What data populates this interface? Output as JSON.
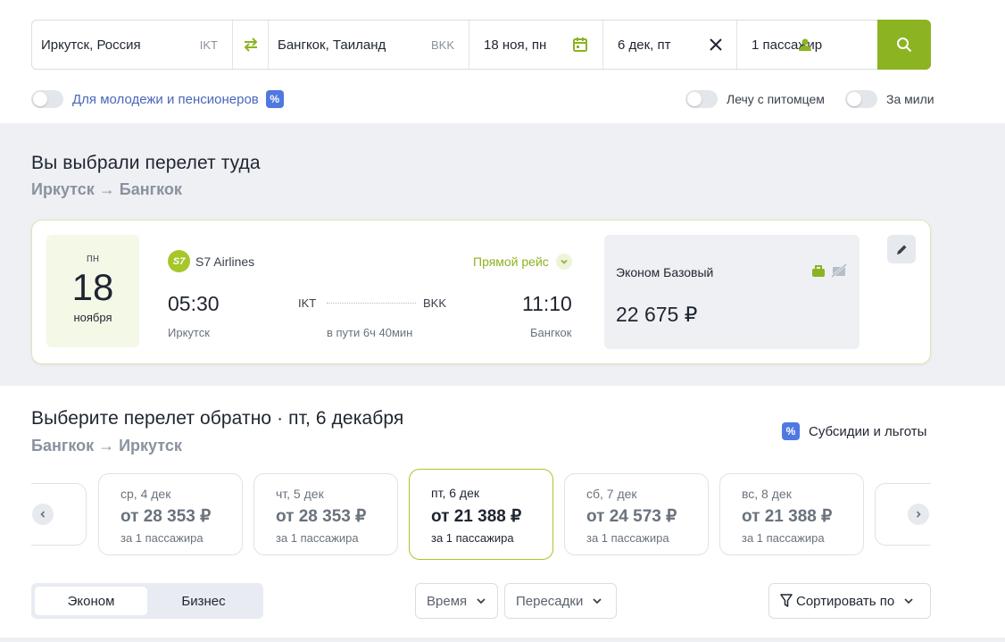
{
  "search": {
    "from_city": "Иркутск, Россия",
    "from_code": "IKT",
    "to_city": "Бангкок, Таиланд",
    "to_code": "BKK",
    "date_out": "18 ноя, пн",
    "date_back": "6 дек, пт",
    "passengers": "1 пассажир"
  },
  "options": {
    "youth": "Для молодежи и пенсионеров",
    "pet": "Лечу с питомцем",
    "miles": "За мили",
    "pct": "%"
  },
  "selected": {
    "title": "Вы выбрали перелет туда",
    "route": "Иркутск → Бангкок",
    "dow": "пн",
    "day": "18",
    "month": "ноября",
    "airline": "S7 Airlines",
    "airline_logo": "S7",
    "direct": "Прямой рейс",
    "dep_time": "05:30",
    "arr_time": "11:10",
    "dep_code": "IKT",
    "arr_code": "BKK",
    "dep_city": "Иркутск",
    "arr_city": "Бангкок",
    "duration": "в пути 6ч 40мин",
    "fare_name": "Эконом Базовый",
    "fare_price": "22 675 ₽"
  },
  "return": {
    "title": "Выберите перелет обратно · пт, 6 декабря",
    "route": "Бангкок → Иркутск",
    "subsidies": "Субсидии и льготы",
    "days": [
      {
        "date": "ср, 4 дек",
        "price": "от 28 353 ₽",
        "pax": "за 1 пассажира"
      },
      {
        "date": "чт, 5 дек",
        "price": "от 28 353 ₽",
        "pax": "за 1 пассажира"
      },
      {
        "date": "пт, 6 дек",
        "price": "от 21 388 ₽",
        "pax": "за 1 пассажира"
      },
      {
        "date": "сб, 7 дек",
        "price": "от 24 573 ₽",
        "pax": "за 1 пассажира"
      },
      {
        "date": "вс, 8 дек",
        "price": "от 21 388 ₽",
        "pax": "за 1 пассажира"
      }
    ]
  },
  "filters": {
    "tab_economy": "Эконом",
    "tab_business": "Бизнес",
    "time": "Время",
    "transfers": "Пересадки",
    "sort": "Сортировать по"
  },
  "colors": {
    "accent": "#8cb321",
    "blue": "#4f78e1"
  }
}
